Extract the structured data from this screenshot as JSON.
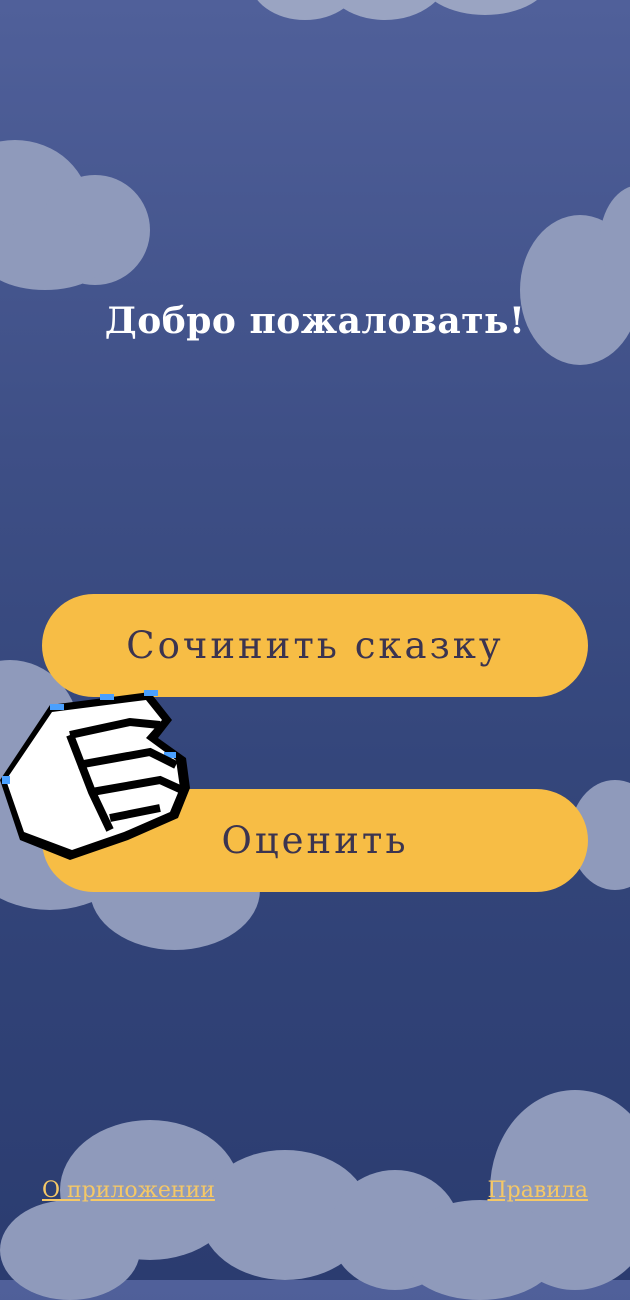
{
  "title": "Добро пожаловать!",
  "buttons": {
    "compose": "Сочинить сказку",
    "rate": "Оценить"
  },
  "links": {
    "about": "О приложении",
    "rules": "Правила"
  },
  "colors": {
    "background_top": "#50609a",
    "background_bottom": "#2b3c70",
    "button": "#f7bd45",
    "button_text": "#3b3450",
    "link": "#f5c866",
    "cloud": "#8f9abb"
  },
  "icons": {
    "cursor": "pointing-hand-cursor-icon"
  }
}
